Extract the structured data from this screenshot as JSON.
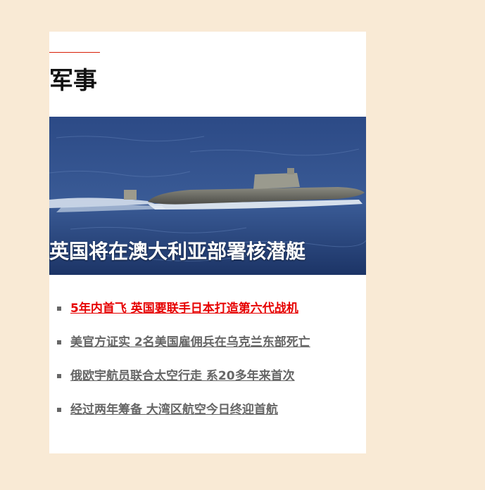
{
  "section": {
    "title": "军事"
  },
  "hero": {
    "caption": "英国将在澳大利亚部署核潜艇",
    "image_subject": "submarine-at-sea"
  },
  "news": {
    "items": [
      {
        "title": "5年内首飞 英国要联手日本打造第六代战机",
        "active": true
      },
      {
        "title": "美官方证实 2名美国雇佣兵在乌克兰东部死亡",
        "active": false
      },
      {
        "title": "俄欧宇航员联合太空行走 系20多年来首次",
        "active": false
      },
      {
        "title": "经过两年筹备 大湾区航空今日终迎首航",
        "active": false
      }
    ]
  },
  "colors": {
    "page_background": "#f9ead5",
    "card_background": "#ffffff",
    "accent": "#d81e06",
    "active_link": "#e60000",
    "link": "#666666"
  }
}
